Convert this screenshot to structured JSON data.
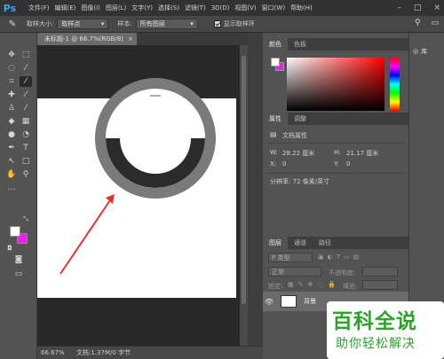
{
  "app": {
    "logo": "Ps"
  },
  "menu": {
    "items": [
      "文件(F)",
      "编辑(E)",
      "图像(I)",
      "图层(L)",
      "文字(Y)",
      "选择(S)",
      "滤镜(T)",
      "3D(D)",
      "视图(V)",
      "窗口(W)",
      "帮助(H)"
    ]
  },
  "window_controls": {
    "minimize": "–",
    "restore": "□",
    "close": "×"
  },
  "options_bar": {
    "tool_icon": "eyedropper-icon",
    "sample_size_label": "取样大小:",
    "sample_size_value": "取样点",
    "sample_label": "样本:",
    "sample_value": "所有图层",
    "show_ring_label": "显示取样环"
  },
  "document": {
    "tab_title": "未标题-1 @ 66.7%(RGB/8)",
    "tab_close": "×",
    "zoom": "66.67%",
    "info": "文档:1.37M/0 字节"
  },
  "color_panel": {
    "tabs": [
      "颜色",
      "色板"
    ],
    "foreground": "#ffffff",
    "background": "#ee1cee"
  },
  "properties_panel": {
    "tabs": [
      "属性",
      "调整"
    ],
    "section_title": "文档属性",
    "width_label": "W:",
    "width_value": "28.22 厘米",
    "height_label": "H:",
    "height_value": "21.17 厘米",
    "x_label": "X:",
    "x_value": "0",
    "y_label": "Y:",
    "y_value": "0",
    "resolution": "分辨率: 72 像素/英寸"
  },
  "layers_panel": {
    "tabs": [
      "图层",
      "通道",
      "路径"
    ],
    "filter_placeholder": "P 类型",
    "blend_mode": "正常",
    "opacity_label": "不透明度:",
    "lock_label": "锁定:",
    "fill_label": "填充:",
    "layer_name": "背景"
  },
  "far_right": {
    "label": "库"
  },
  "watermark": {
    "title": "百科全说",
    "subtitle": "助你轻松解决"
  }
}
